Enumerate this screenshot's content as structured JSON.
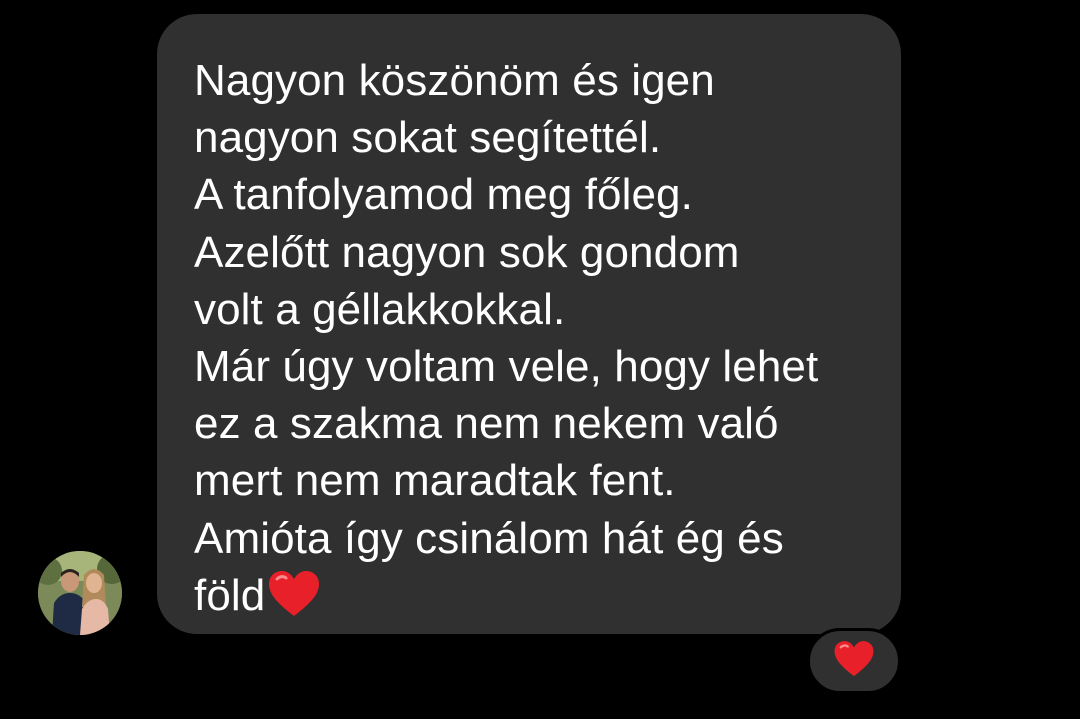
{
  "message": {
    "lines": [
      "Nagyon köszönöm és igen",
      "nagyon sokat segítettél.",
      "A tanfolyamod meg főleg.",
      "Azelőtt nagyon sok gondom",
      "volt a géllakkokkal.",
      "Már úgy voltam vele, hogy lehet",
      "ez a szakma nem nekem való",
      "mert nem maradtak fent.",
      "Amióta így csinálom hát ég és",
      "föld"
    ],
    "trailing_icon": "red-heart-emoji"
  },
  "reaction": {
    "icon": "red-heart-emoji"
  },
  "colors": {
    "background": "#000000",
    "bubble": "#303030",
    "text": "#ffffff",
    "heart": "#e8202a"
  }
}
